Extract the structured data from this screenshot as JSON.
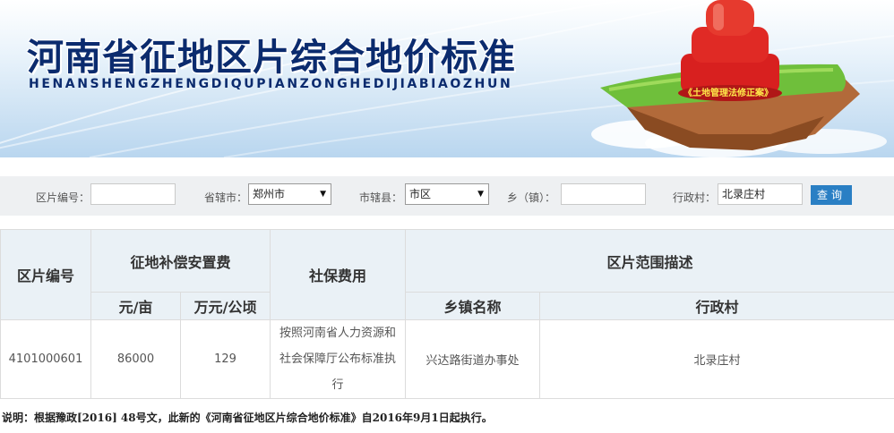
{
  "banner": {
    "title": "河南省征地区片综合地价标准",
    "pinyin": "HENANSHENGZHENGDIQUPIANZONGHEDIJIABIAOZHUN",
    "seal_text": "《土地管理法修正案》",
    "colors": {
      "title": "#0b2b6e",
      "seal": "#d8201f"
    }
  },
  "search": {
    "district_code_label": "区片编号：",
    "district_code_value": "",
    "city_label": "省辖市：",
    "city_value": "郑州市",
    "county_label": "市辖县：",
    "county_value": "市区",
    "town_label": "乡（镇）：",
    "town_value": "",
    "village_label": "行政村：",
    "village_value": "北录庄村",
    "query_button": "查询",
    "colors": {
      "button": "#2a7fc4"
    }
  },
  "table": {
    "headers": {
      "code": "区片编号",
      "compensation": "征地补偿安置费",
      "yuan_per_mu": "元/亩",
      "wan_per_hectare": "万元/公顷",
      "social_security": "社保费用",
      "description": "区片范围描述",
      "town_name": "乡镇名称",
      "village": "行政村"
    },
    "rows": [
      {
        "code": "4101000601",
        "yuan_per_mu": "86000",
        "wan_per_hectare": "129",
        "social_security": "按照河南省人力资源和社会保障厅公布标准执行",
        "town_name": "兴达路街道办事处",
        "village": "北录庄村"
      }
    ]
  },
  "note": "说明：根据豫政[2016] 48号文，此新的《河南省征地区片综合地价标准》自2016年9月1日起执行。"
}
